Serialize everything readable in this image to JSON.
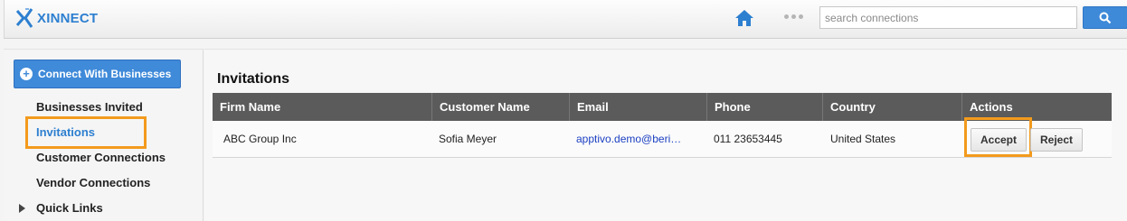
{
  "app": {
    "name": "XINNECT"
  },
  "search": {
    "placeholder": "search connections",
    "value": ""
  },
  "icons": {
    "logo": "x-logo-icon",
    "home": "home-icon",
    "more": "more-dots-icon",
    "search": "search-icon",
    "add": "plus-circle-icon",
    "expand": "triangle-right-icon"
  },
  "colors": {
    "accent": "#3e89d8",
    "highlight": "#f39a1d",
    "table_header": "#5b5b5b"
  },
  "sidebar": {
    "connect_button": "Connect With Businesses",
    "items": [
      {
        "label": "Businesses Invited"
      },
      {
        "label": "Invitations"
      },
      {
        "label": "Customer Connections"
      },
      {
        "label": "Vendor Connections"
      },
      {
        "label": "Quick Links"
      }
    ]
  },
  "main": {
    "title": "Invitations",
    "columns": [
      "Firm Name",
      "Customer Name",
      "Email",
      "Phone",
      "Country",
      "Actions"
    ],
    "rows": [
      {
        "firm": "ABC Group Inc",
        "customer": "Sofia Meyer",
        "email": "apptivo.demo@beri…",
        "phone": "011 23653445",
        "country": "United States",
        "accept": "Accept",
        "reject": "Reject"
      }
    ]
  }
}
